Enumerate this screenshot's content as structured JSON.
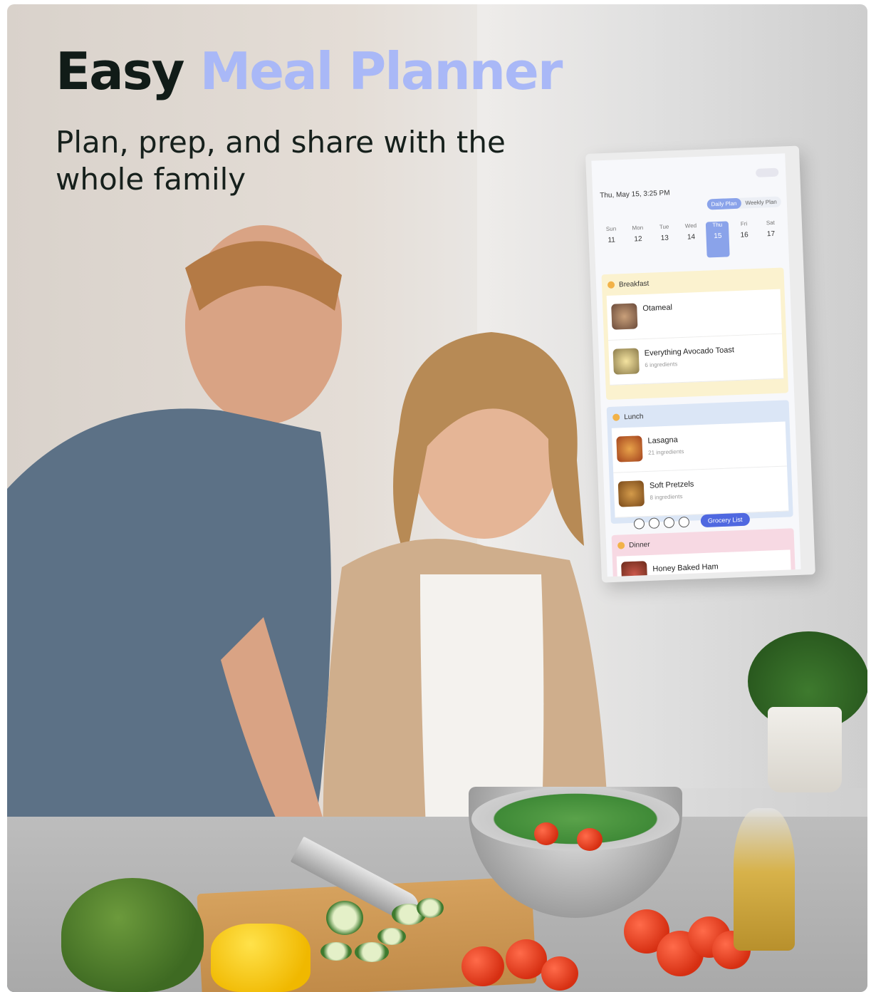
{
  "headline": {
    "part1": "Easy",
    "part2": "Meal Planner"
  },
  "subtitle": "Plan, prep, and share with the whole family",
  "colors": {
    "accent": "#a9b8f7",
    "dark": "#111c18",
    "tablet_accent": "#8aa3ea",
    "grocery_button": "#4f68e0"
  },
  "tablet": {
    "datetime": "Thu, May 15, 3:25 PM",
    "views": {
      "daily": "Daily Plan",
      "weekly": "Weekly Plan"
    },
    "days": [
      {
        "name": "Sun",
        "num": "11"
      },
      {
        "name": "Mon",
        "num": "12"
      },
      {
        "name": "Tue",
        "num": "13"
      },
      {
        "name": "Wed",
        "num": "14"
      },
      {
        "name": "Thu",
        "num": "15"
      },
      {
        "name": "Fri",
        "num": "16"
      },
      {
        "name": "Sat",
        "num": "17"
      }
    ],
    "breakfast": {
      "title": "Breakfast",
      "items": [
        {
          "name": "Otameal",
          "sub": ""
        },
        {
          "name": "Everything Avocado Toast",
          "sub": "6 ingredients"
        }
      ]
    },
    "lunch": {
      "title": "Lunch",
      "items": [
        {
          "name": "Lasagna",
          "sub": "21 ingredients"
        },
        {
          "name": "Soft Pretzels",
          "sub": "8 ingredients"
        }
      ]
    },
    "dinner": {
      "title": "Dinner",
      "items": [
        {
          "name": "Honey Baked Ham",
          "sub": ""
        }
      ]
    },
    "grocery_button": "Grocery List",
    "bottom_icons": [
      "egg-icon",
      "burger-icon",
      "salad-icon",
      "snack-icon"
    ]
  }
}
